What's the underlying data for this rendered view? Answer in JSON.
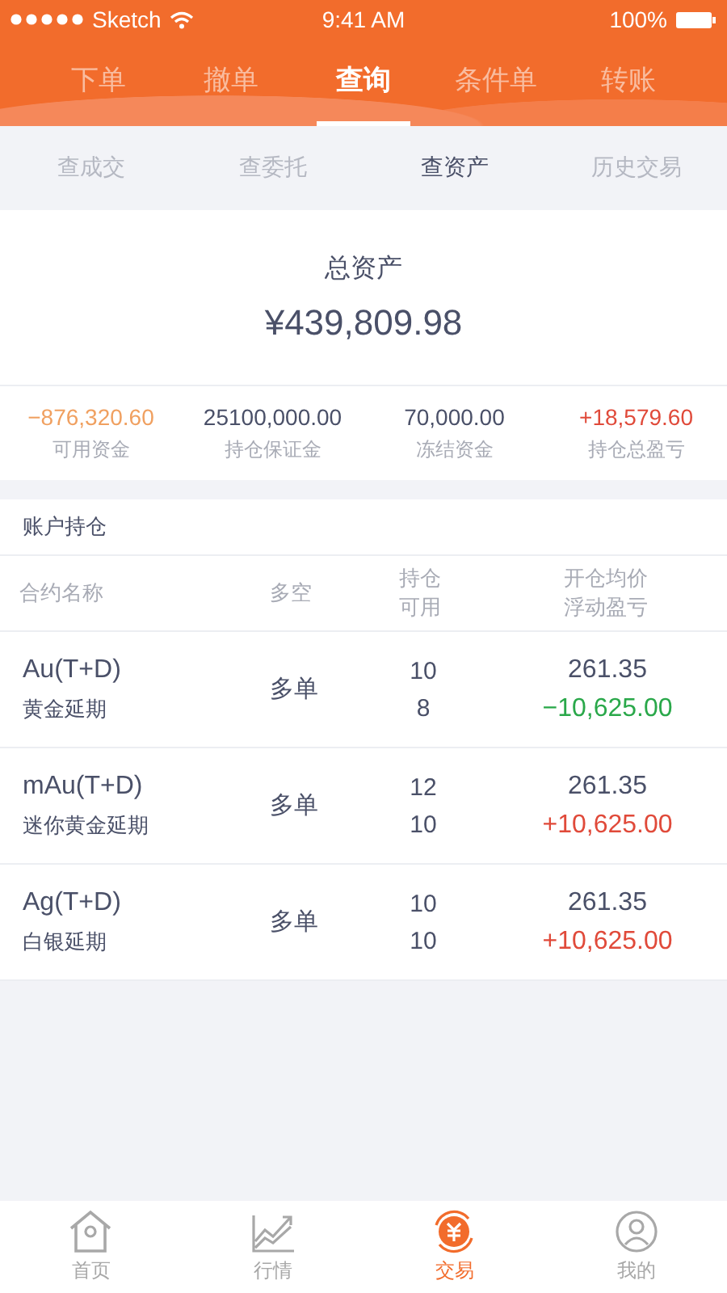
{
  "status_bar": {
    "carrier": "Sketch",
    "time": "9:41 AM",
    "battery": "100%"
  },
  "tabs": [
    {
      "label": "下单",
      "selected": false
    },
    {
      "label": "撤单",
      "selected": false
    },
    {
      "label": "查询",
      "selected": true
    },
    {
      "label": "条件单",
      "selected": false
    },
    {
      "label": "转账",
      "selected": false
    }
  ],
  "sub_tabs": [
    {
      "label": "查成交",
      "selected": false
    },
    {
      "label": "查委托",
      "selected": false
    },
    {
      "label": "查资产",
      "selected": true
    },
    {
      "label": "历史交易",
      "selected": false
    }
  ],
  "total": {
    "label": "总资产",
    "value": "¥439,809.98"
  },
  "summary": [
    {
      "value": "−876,320.60",
      "label": "可用资金",
      "color": "#f0a060"
    },
    {
      "value": "25100,000.00",
      "label": "持仓保证金",
      "color": "#4a5068"
    },
    {
      "value": "70,000.00",
      "label": "冻结资金",
      "color": "#4a5068"
    },
    {
      "value": "+18,579.60",
      "label": "持仓总盈亏",
      "color": "#e04a3a"
    }
  ],
  "positions": {
    "title": "账户持仓",
    "columns": [
      [
        "合约名称"
      ],
      [
        "多空"
      ],
      [
        "持仓",
        "可用"
      ],
      [
        "开仓均价",
        "浮动盈亏"
      ]
    ],
    "rows": [
      {
        "code": "Au(T+D)",
        "name": "黄金延期",
        "side": "多单",
        "hold": "10",
        "available": "8",
        "price": "261.35",
        "pnl": "−10,625.00",
        "color": "#2aa84a"
      },
      {
        "code": "mAu(T+D)",
        "name": "迷你黄金延期",
        "side": "多单",
        "hold": "12",
        "available": "10",
        "price": "261.35",
        "pnl": "+10,625.00",
        "color": "#e04a3a"
      },
      {
        "code": "Ag(T+D)",
        "name": "白银延期",
        "side": "多单",
        "hold": "10",
        "available": "10",
        "price": "261.35",
        "pnl": "+10,625.00",
        "color": "#e04a3a"
      }
    ]
  },
  "bottom_nav": [
    {
      "kind": "home",
      "label": "首页",
      "selected": false
    },
    {
      "kind": "market",
      "label": "行情",
      "selected": false
    },
    {
      "kind": "trade",
      "label": "交易",
      "selected": true
    },
    {
      "kind": "profile",
      "label": "我的",
      "selected": false
    }
  ]
}
